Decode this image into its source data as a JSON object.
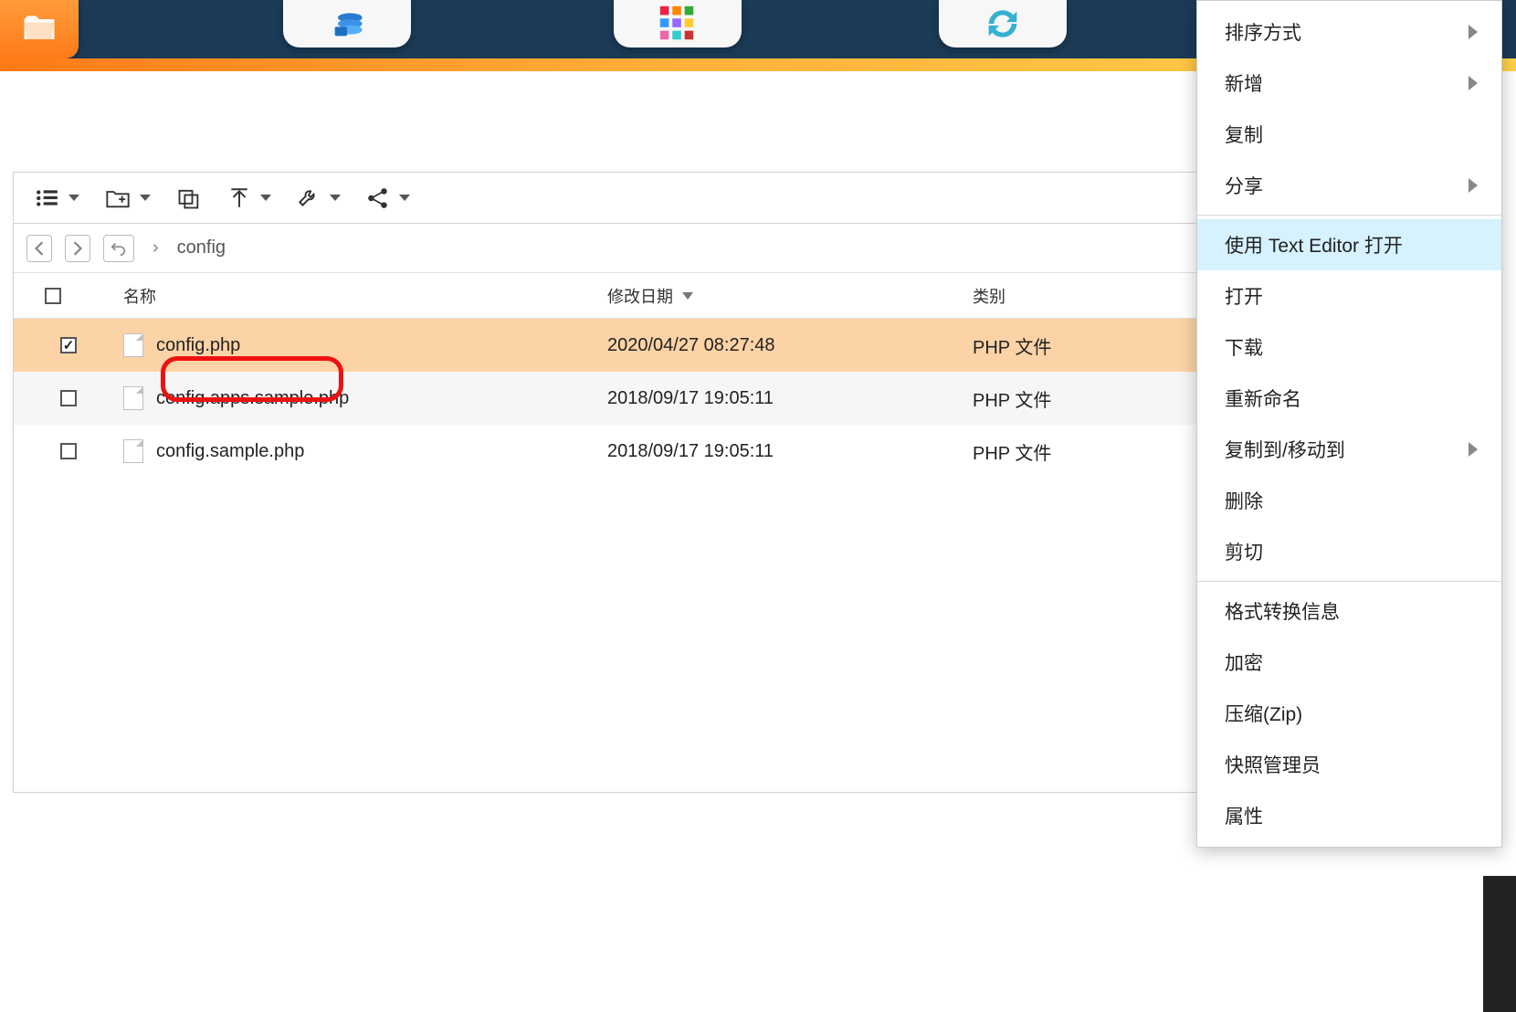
{
  "breadcrumb": {
    "current": "config"
  },
  "columns": {
    "check": "",
    "name": "名称",
    "modified": "修改日期",
    "category": "类别"
  },
  "files": [
    {
      "name": "config.php",
      "modified": "2020/04/27 08:27:48",
      "category": "PHP 文件",
      "checked": true
    },
    {
      "name": "config.apps.sample.php",
      "modified": "2018/09/17 19:05:11",
      "category": "PHP 文件",
      "checked": false
    },
    {
      "name": "config.sample.php",
      "modified": "2018/09/17 19:05:11",
      "category": "PHP 文件",
      "checked": false
    }
  ],
  "context_menu": {
    "sort": "排序方式",
    "new": "新增",
    "copy": "复制",
    "share": "分享",
    "open_text": "使用 Text Editor 打开",
    "open": "打开",
    "download": "下载",
    "rename": "重新命名",
    "copymove": "复制到/移动到",
    "delete": "删除",
    "cut": "剪切",
    "transcode": "格式转换信息",
    "encrypt": "加密",
    "zip": "压缩(Zip)",
    "snapshot": "快照管理员",
    "properties": "属性"
  }
}
